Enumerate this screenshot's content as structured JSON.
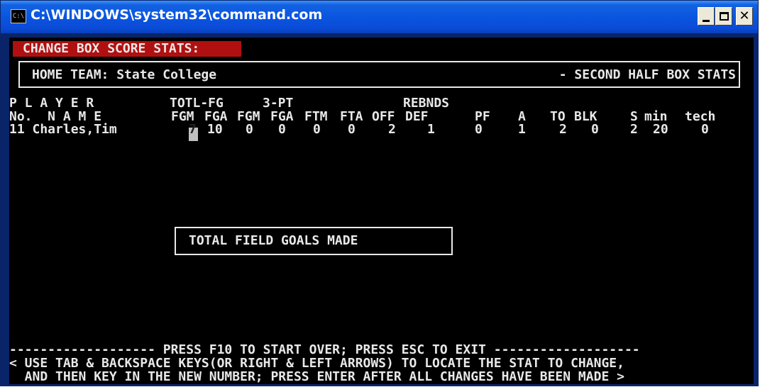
{
  "window": {
    "title": "C:\\WINDOWS\\system32\\command.com",
    "icon_label": "C:\\"
  },
  "heading": "CHANGE BOX SCORE STATS:",
  "team": {
    "left": "HOME TEAM: State College",
    "right": "- SECOND HALF BOX STATS"
  },
  "headers": {
    "row1": {
      "player": "P L A Y E R",
      "totl_fg": "TOTL-FG",
      "three_pt": "3-PT",
      "rebnds": "REBNDS"
    },
    "row2": {
      "no_name": "No.  N A M E",
      "fgm": "FGM",
      "fga": "FGA",
      "fgm3": "FGM",
      "fga3": "FGA",
      "ftm": "FTM",
      "fta": "FTA",
      "off": "OFF",
      "def": "DEF",
      "pf": "PF",
      "a": "A",
      "to": "TO",
      "blk": "BLK",
      "s": "S",
      "min": "min",
      "tech": "tech"
    }
  },
  "player": {
    "number_name": "11 Charles,Tim",
    "fgm": "7",
    "fga": "10",
    "fgm3": "0",
    "fga3": "0",
    "ftm": "0",
    "fta": "0",
    "off": "2",
    "def": "1",
    "pf": "0",
    "a": "1",
    "to": "2",
    "blk": "0",
    "s": "2",
    "min": "20",
    "tech": "0"
  },
  "message": "TOTAL FIELD GOALS MADE",
  "footer": {
    "line1": "------------------- PRESS F10 TO START OVER; PRESS ESC TO EXIT -------------------",
    "line2": "< USE TAB & BACKSPACE KEYS(OR RIGHT & LEFT ARROWS) TO LOCATE THE STAT TO CHANGE,",
    "line3": "  AND THEN KEY IN THE NEW NUMBER; PRESS ENTER AFTER ALL CHANGES HAVE BEEN MADE >"
  }
}
